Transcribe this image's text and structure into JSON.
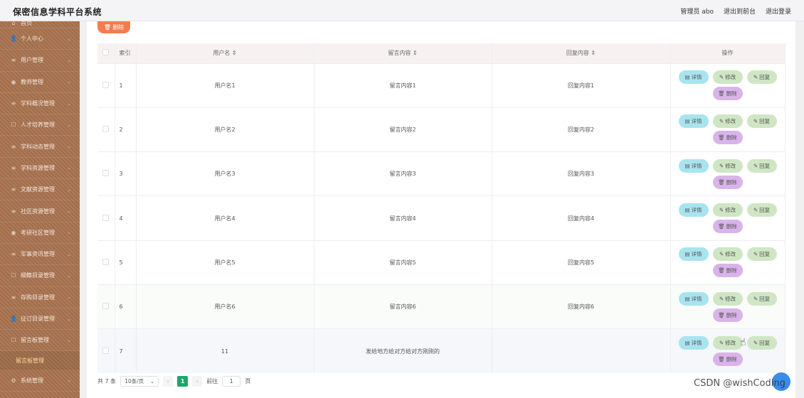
{
  "header": {
    "title": "保密信息学科平台系统",
    "admin": "管理员 abo",
    "back_front": "退出到前台",
    "logout": "退出登录"
  },
  "sidebar": {
    "top_clip": "首页",
    "items": [
      {
        "label": "个人中心",
        "icon": "person-icon"
      },
      {
        "label": "用户管理",
        "icon": "list-icon"
      },
      {
        "label": "教师管理",
        "icon": "pin-icon"
      },
      {
        "label": "学科概况管理",
        "icon": "list-icon"
      },
      {
        "label": "人才培养管理",
        "icon": "chat-icon"
      },
      {
        "label": "学科动态管理",
        "icon": "list-icon"
      },
      {
        "label": "学科资源管理",
        "icon": "list-icon"
      },
      {
        "label": "文献资源管理",
        "icon": "list-icon"
      },
      {
        "label": "社区资源管理",
        "icon": "list-icon"
      },
      {
        "label": "考研社区管理",
        "icon": "pin-icon"
      },
      {
        "label": "军事资讯管理",
        "icon": "list-icon"
      },
      {
        "label": "细籍目录管理",
        "icon": "chat-icon"
      },
      {
        "label": "存购目录管理",
        "icon": "list-icon"
      },
      {
        "label": "征订目录管理",
        "icon": "person-icon"
      },
      {
        "label": "留言板管理",
        "icon": "chat-icon"
      }
    ],
    "sub_item": "留言板管理",
    "bottom_item": "系统管理"
  },
  "toolbar": {
    "delete_label": "删除"
  },
  "table": {
    "headers": [
      "索引",
      "用户名 ⇕",
      "留言内容 ⇕",
      "回复内容 ⇕",
      "操作"
    ],
    "rows": [
      {
        "index": "1",
        "user": "用户名1",
        "msg": "留言内容1",
        "reply": "回复内容1"
      },
      {
        "index": "2",
        "user": "用户名2",
        "msg": "留言内容2",
        "reply": "回复内容2"
      },
      {
        "index": "3",
        "user": "用户名3",
        "msg": "留言内容3",
        "reply": "回复内容3"
      },
      {
        "index": "4",
        "user": "用户名4",
        "msg": "留言内容4",
        "reply": "回复内容4"
      },
      {
        "index": "5",
        "user": "用户名5",
        "msg": "留言内容5",
        "reply": "回复内容5"
      },
      {
        "index": "6",
        "user": "用户名6",
        "msg": "留言内容6",
        "reply": "回复内容6"
      },
      {
        "index": "7",
        "user": "11",
        "msg": "发给地方给对方给对方刚刚的",
        "reply": ""
      }
    ],
    "actions": {
      "detail": "详情",
      "edit": "修改",
      "reply": "回复",
      "delete": "删除"
    }
  },
  "pagination": {
    "total": "共 7 条",
    "page_size": "10条/页",
    "current": "1",
    "goto_label": "前往",
    "goto_value": "1",
    "page_unit": "页"
  },
  "watermark": "CSDN @wishCoding"
}
